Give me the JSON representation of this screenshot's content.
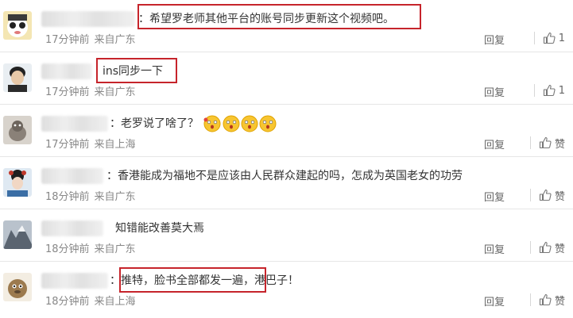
{
  "comments": [
    {
      "text": "：希望罗老师其他平台的账号同步更新这个视频吧。",
      "time": "17分钟前",
      "source": "来自广东",
      "reply": "回复",
      "like_label": "1"
    },
    {
      "text": "ins同步一下",
      "time": "17分钟前",
      "source": "来自广东",
      "reply": "回复",
      "like_label": "1"
    },
    {
      "text": "：老罗说了啥了？",
      "time": "17分钟前",
      "source": "来自上海",
      "reply": "回复",
      "like_label": "赞"
    },
    {
      "text": "：香港能成为福地不是应该由人民群众建起的吗，怎成为英国老女的功劳",
      "time": "18分钟前",
      "source": "来自广东",
      "reply": "回复",
      "like_label": "赞"
    },
    {
      "text": "知错能改善莫大焉",
      "time": "18分钟前",
      "source": "来自广东",
      "reply": "回复",
      "like_label": "赞"
    },
    {
      "text": "推特，脸书全部都发一遍，港巴子！",
      "time": "18分钟前",
      "source": "来自上海",
      "reply": "回复",
      "like_label": "赞"
    }
  ],
  "colors": {
    "highlight": "#c6242b",
    "meta": "#888888",
    "divider": "#e6e6e6"
  },
  "icons": {
    "like": "thumbs-up-icon",
    "emoji": "surprised-face-emoji"
  }
}
